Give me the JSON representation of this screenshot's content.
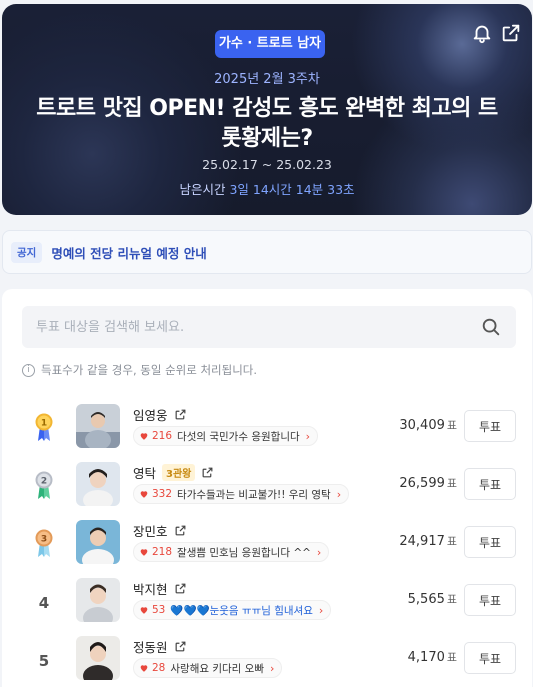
{
  "banner": {
    "category": "가수 · 트로트 남자",
    "week": "2025년 2월 3주차",
    "title": "트로트 맛집 OPEN! 감성도 흥도 완벽한 최고의 트롯황제는?",
    "dates": "25.02.17 ~ 25.02.23",
    "remain_label": "남은시간",
    "remain_value": "3일 14시간 14분 33초",
    "icons": [
      "bell-icon",
      "share-icon"
    ]
  },
  "notice": {
    "tag": "공지",
    "text": "명예의 전당 리뉴얼 예정 안내"
  },
  "search": {
    "placeholder": "투표 대상을 검색해 보세요."
  },
  "info_text": "득표수가 같을 경우, 동일 순위로 처리됩니다.",
  "vote_button_label": "투표",
  "votes_unit": "표",
  "colors": {
    "accent": "#3a63f0",
    "cheer_red": "#e8473c",
    "gold": "#f2b632",
    "silver": "#b7bcc6",
    "bronze": "#e39a58"
  },
  "candidates": [
    {
      "rank": "1",
      "name": "임영웅",
      "badge": "",
      "cheer_count": "216",
      "cheer_text": "다섯의 국민가수 응원합니다",
      "votes": "30,409"
    },
    {
      "rank": "2",
      "name": "영탁",
      "badge": "3관왕",
      "cheer_count": "332",
      "cheer_text": "타가수들과는 비교불가!! 우리 영탁",
      "votes": "26,599"
    },
    {
      "rank": "3",
      "name": "장민호",
      "badge": "",
      "cheer_count": "218",
      "cheer_text": "잘생쁨 민호님 응원합니다 ^^",
      "votes": "24,917"
    },
    {
      "rank": "4",
      "name": "박지현",
      "badge": "",
      "cheer_count": "53",
      "cheer_text": "💙💙💙눈웃음 ㅠㅠ님 힘내셔요",
      "votes": "5,565"
    },
    {
      "rank": "5",
      "name": "정동원",
      "badge": "",
      "cheer_count": "28",
      "cheer_text": "사랑해요 키다리 오빠",
      "votes": "4,170"
    }
  ]
}
